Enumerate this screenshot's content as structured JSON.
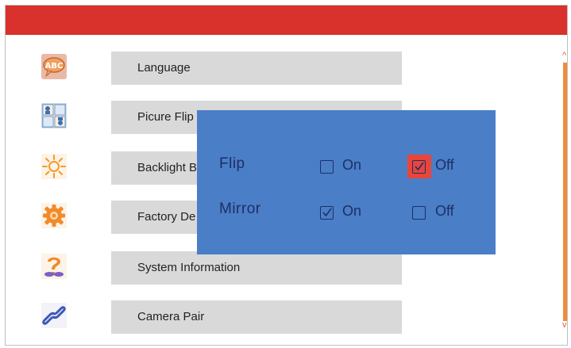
{
  "menu": {
    "items": [
      {
        "label": "Language",
        "icon": "abc-speech-icon"
      },
      {
        "label": "Picure Flip",
        "icon": "flip-grid-icon"
      },
      {
        "label": "Backlight B",
        "icon": "sun-icon"
      },
      {
        "label": "Factory De",
        "icon": "gear-icon"
      },
      {
        "label": "System Information",
        "icon": "question-icon"
      },
      {
        "label": "Camera Pair",
        "icon": "link-icon"
      }
    ]
  },
  "popup": {
    "flip": {
      "label": "Flip",
      "on_label": "On",
      "off_label": "Off",
      "selected": "Off"
    },
    "mirror": {
      "label": "Mirror",
      "on_label": "On",
      "off_label": "Off",
      "selected": "On"
    }
  },
  "scrollbar": {
    "up": "^",
    "down": "v"
  },
  "colors": {
    "header": "#d9312b",
    "popup_bg": "#4a7ec7",
    "popup_text": "#1d2f66",
    "highlight": "#e8463c",
    "scrollbar": "#f08b3c",
    "menu_bar": "#d9d9d9"
  }
}
